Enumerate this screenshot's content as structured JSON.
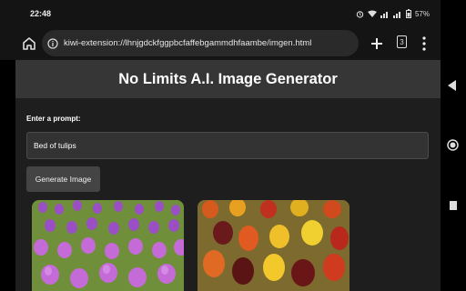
{
  "status": {
    "time": "22:48",
    "battery": "57%"
  },
  "browser": {
    "url": "kiwi-extension://lhnjgdckfggpbcfaffebgammdhfaambe/imgen.html",
    "tab_count": "3"
  },
  "page": {
    "title": "No Limits A.I. Image Generator",
    "prompt_label": "Enter a prompt:",
    "prompt_value": "Bed of tulips",
    "generate_label": "Generate Image"
  },
  "images": [
    {
      "name": "purple-tulips-image"
    },
    {
      "name": "red-yellow-tulips-image"
    }
  ],
  "colors": {
    "header_bg": "#363636",
    "page_bg": "#1e1e1e",
    "button_bg": "#444444"
  }
}
